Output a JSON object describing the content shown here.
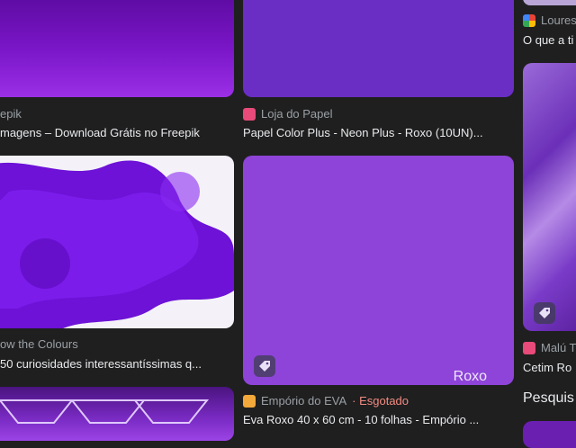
{
  "results": [
    {
      "source": "epik",
      "title": "magens – Download Grátis no Freepik"
    },
    {
      "source": "Loja do Papel",
      "title": "Papel Color Plus - Neon Plus - Roxo (10UN)..."
    },
    {
      "source": "Loures",
      "title": "O que a ti"
    },
    {
      "source": "ow the Colours",
      "title": "50 curiosidades interessantíssimas q..."
    },
    {
      "source": "Empório do EVA",
      "status": "· Esgotado",
      "title": "Eva Roxo 40 x 60 cm - 10 folhas - Empório ...",
      "image_text": "Roxo"
    },
    {
      "source": "Malú T",
      "title": "Cetim Ro"
    }
  ],
  "related_heading": "Pesquis",
  "colors": {
    "accent_sold": "#f28b82",
    "purple": "#8e44d8"
  }
}
